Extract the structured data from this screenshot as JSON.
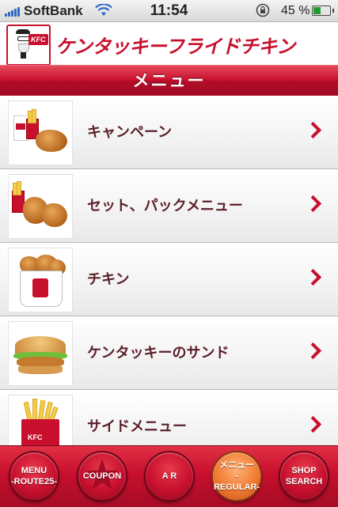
{
  "status_bar": {
    "carrier": "SoftBank",
    "time": "11:54",
    "battery_percent": "45 %",
    "battery_level": 0.45
  },
  "brand": {
    "logo_text": "KFC",
    "name": "ケンタッキーフライドチキン"
  },
  "title": "メニュー",
  "menu_items": [
    {
      "label": "キャンペーン",
      "thumb": "campaign-image"
    },
    {
      "label": "セット、パックメニュー",
      "thumb": "set-pack-image"
    },
    {
      "label": "チキン",
      "thumb": "chicken-bucket-image"
    },
    {
      "label": "ケンタッキーのサンド",
      "thumb": "sandwich-image"
    },
    {
      "label": "サイドメニュー",
      "thumb": "fries-image"
    }
  ],
  "tabs": [
    {
      "line1": "MENU",
      "line2": "-ROUTE25-"
    },
    {
      "line1": "COUPON",
      "line2": ""
    },
    {
      "line1": "A R",
      "line2": ""
    },
    {
      "line1": "メニュー",
      "line2": "-REGULAR-"
    },
    {
      "line1": "SHOP",
      "line2": "SEARCH"
    }
  ],
  "colors": {
    "brand_red": "#c8102e",
    "active_tab": "#f0792f",
    "label_text": "#5a1e28"
  }
}
